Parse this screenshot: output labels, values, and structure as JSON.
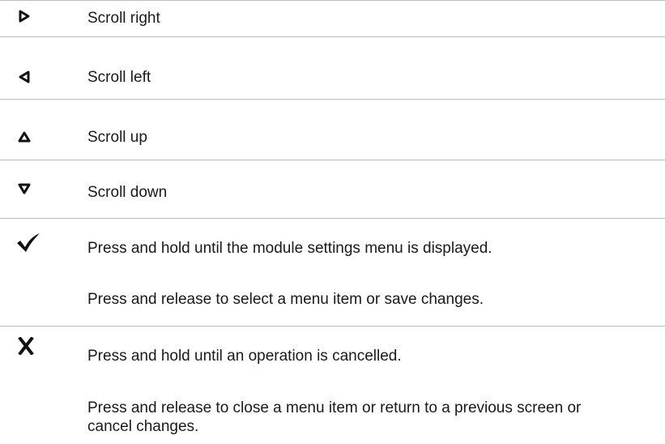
{
  "rows": [
    {
      "icon": "triangle-right-outline-icon",
      "lines": [
        "Scroll right"
      ]
    },
    {
      "icon": "triangle-left-outline-icon",
      "lines": [
        "Scroll left"
      ]
    },
    {
      "icon": "triangle-up-outline-icon",
      "lines": [
        "Scroll up"
      ]
    },
    {
      "icon": "triangle-down-outline-icon",
      "lines": [
        "Scroll down"
      ]
    },
    {
      "icon": "check-icon",
      "lines": [
        "Press and hold until the module settings menu is displayed.",
        "Press and release to select a menu item or save changes."
      ]
    },
    {
      "icon": "x-icon",
      "lines": [
        "Press and hold until an operation is cancelled.",
        "Press and release to close a menu item or return to a previous screen or cancel changes."
      ]
    }
  ]
}
